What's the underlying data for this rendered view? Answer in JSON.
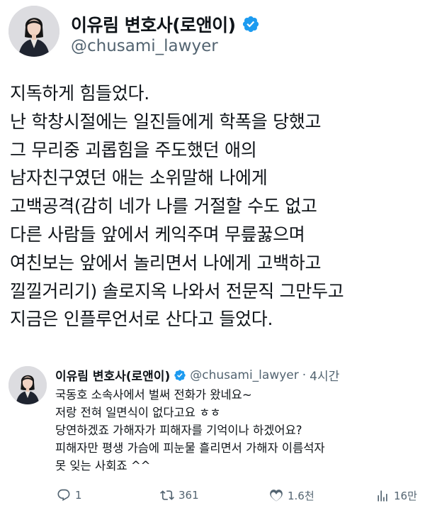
{
  "author": {
    "display_name": "이유림 변호사(로앤이)",
    "handle": "@chusami_lawyer",
    "verified": true,
    "verified_color": "#1d9bf0"
  },
  "tweet": {
    "lines": [
      "지독하게 힘들었다.",
      "난 학창시절에는 일진들에게 학폭을 당했고",
      "그 무리중 괴롭힘을 주도했던 애의",
      "남자친구였던 애는 소위말해 나에게",
      "고백공격(감히 네가 나를 거절할 수도 없고",
      "다른 사람들 앞에서 케익주며 무릎꿇으며",
      "여친보는 앞에서 놀리면서 나에게 고백하고",
      "낄낄거리기) 솔로지옥 나와서 전문직 그만두고",
      "지금은 인플루언서로 산다고 들었다."
    ]
  },
  "quoted_tweet": {
    "display_name": "이유림 변호사(로앤이)",
    "handle": "@chusami_lawyer",
    "separator": "·",
    "time": "4시간",
    "lines": [
      "국동호 소속사에서 벌써 전화가 왔네요~",
      "저랑 전혀 일면식이 없다고요 ㅎㅎ",
      "당연하겠죠 가해자가 피해자를 기억이나 하겠어요?",
      "피해자만 평생 가슴에 피눈물 흘리면서 가해자 이름석자",
      "못 잊는 사회죠 ^^"
    ]
  },
  "actions": {
    "reply": {
      "icon": "reply-icon",
      "count": "1"
    },
    "retweet": {
      "icon": "retweet-icon",
      "count": "361"
    },
    "like": {
      "icon": "heart-icon",
      "count": "1.6천"
    },
    "views": {
      "icon": "views-icon",
      "count": "16만"
    }
  }
}
